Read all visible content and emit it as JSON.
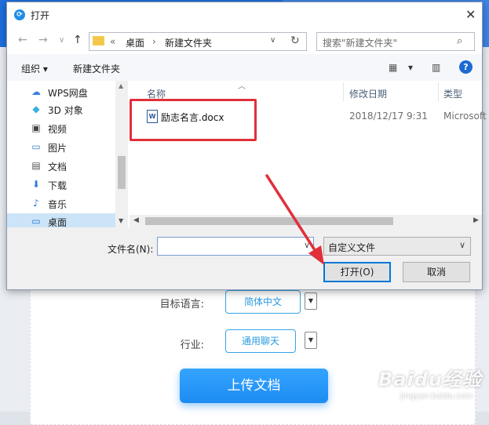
{
  "background": {
    "rows": [
      {
        "label": "目标语言:",
        "value": "简体中文"
      },
      {
        "label": "行业:",
        "value": "通用聊天"
      }
    ],
    "upload_button": "上传文档",
    "watermark": {
      "main": "Baidu经验",
      "sub": "jingyan.baidu.com"
    },
    "colors": {
      "accent": "#1d8cf2",
      "pill_border": "#36a3e6"
    }
  },
  "dialog": {
    "title": "打开",
    "nav": {
      "back": "←",
      "forward": "→",
      "dropdown": "∨",
      "up": "↑",
      "breadcrumb": [
        "«",
        "桌面",
        "›",
        "新建文件夹"
      ],
      "refresh": "↻",
      "search_placeholder": "搜索\"新建文件夹\""
    },
    "toolbar": {
      "organize": "组织 ▾",
      "new_folder": "新建文件夹",
      "view_icon": "▦",
      "view_dropdown": "▾",
      "help": "?"
    },
    "sidebar": {
      "items": [
        {
          "icon": "☁",
          "label": "WPS网盘"
        },
        {
          "icon": "◆",
          "label": "3D 对象"
        },
        {
          "icon": "▣",
          "label": "视频"
        },
        {
          "icon": "▭",
          "label": "图片"
        },
        {
          "icon": "▤",
          "label": "文档"
        },
        {
          "icon": "⬇",
          "label": "下载"
        },
        {
          "icon": "♪",
          "label": "音乐"
        },
        {
          "icon": "▭",
          "label": "桌面"
        }
      ],
      "selected_index": 7
    },
    "columns": {
      "name": "名称",
      "date": "修改日期",
      "type": "类型"
    },
    "files": [
      {
        "icon": "W",
        "name": "励志名言.docx",
        "modified": "2018/12/17 9:31",
        "type": "Microsoft"
      }
    ],
    "filename_label": "文件名(N):",
    "filename_value": "",
    "filter_value": "自定义文件",
    "open_button": "打开(O)",
    "cancel_button": "取消",
    "close": "✕",
    "colors": {
      "selection": "#cce4f7",
      "highlight_box": "#e0303a",
      "primary_border": "#0078d7"
    }
  }
}
